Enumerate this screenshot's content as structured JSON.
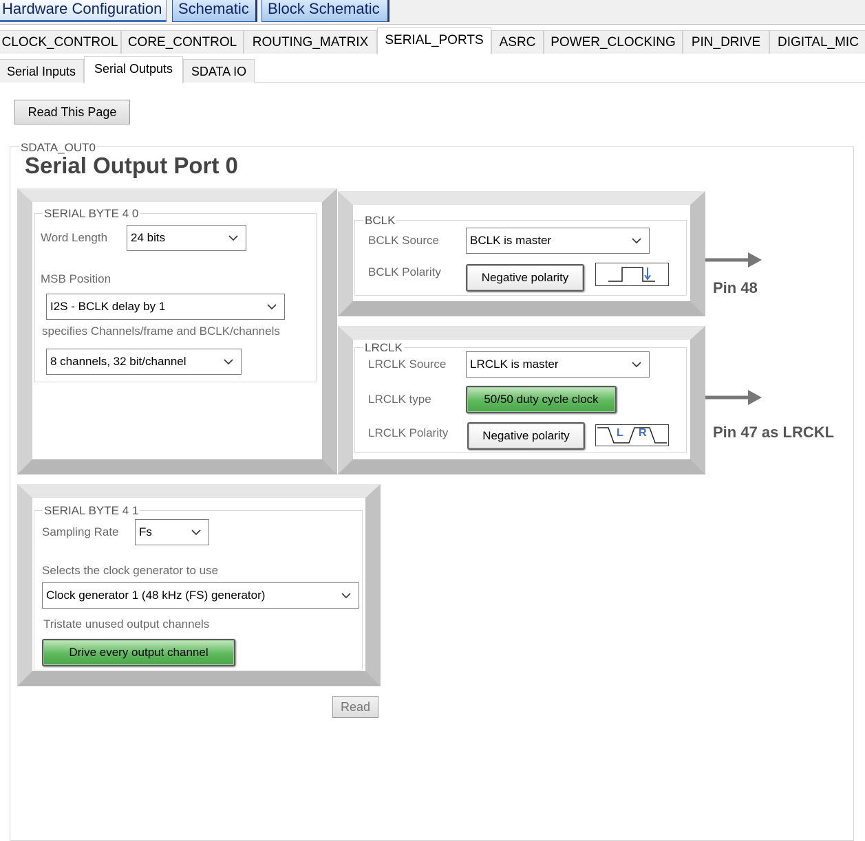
{
  "doc_tabs": [
    {
      "label": "Hardware Configuration",
      "active": true
    },
    {
      "label": "Schematic",
      "active": false
    },
    {
      "label": "Block Schematic",
      "active": false
    }
  ],
  "register_tabs": [
    {
      "label": "CLOCK_CONTROL"
    },
    {
      "label": "CORE_CONTROL"
    },
    {
      "label": "ROUTING_MATRIX"
    },
    {
      "label": "SERIAL_PORTS",
      "active": true
    },
    {
      "label": "ASRC"
    },
    {
      "label": "POWER_CLOCKING"
    },
    {
      "label": "PIN_DRIVE"
    },
    {
      "label": "DIGITAL_MIC"
    }
  ],
  "sub_tabs": [
    {
      "label": "Serial Inputs"
    },
    {
      "label": "Serial Outputs",
      "active": true
    },
    {
      "label": "SDATA IO"
    }
  ],
  "read_page_button": "Read This Page",
  "group": {
    "legend": "SDATA_OUT0",
    "title": "Serial Output Port 0"
  },
  "serial_byte_4_0": {
    "legend": "SERIAL BYTE 4 0",
    "word_length_label": "Word Length",
    "word_length_value": "24 bits",
    "msb_label": "MSB Position",
    "msb_value": "I2S - BCLK delay by 1",
    "channels_label": "specifies Channels/frame and BCLK/channels",
    "channels_value": "8 channels, 32 bit/channel"
  },
  "bclk": {
    "legend": "BCLK",
    "source_label": "BCLK Source",
    "source_value": "BCLK is master",
    "polarity_label": "BCLK Polarity",
    "polarity_button": "Negative polarity",
    "pin": "Pin 48"
  },
  "lrclk": {
    "legend": "LRCLK",
    "source_label": "LRCLK Source",
    "source_value": "LRCLK is master",
    "type_label": "LRCLK type",
    "type_button": "50/50 duty cycle clock",
    "polarity_label": "LRCLK Polarity",
    "polarity_button": "Negative polarity",
    "wave_left": "L",
    "wave_right": "R",
    "pin": "Pin 47 as LRCKL"
  },
  "serial_byte_4_1": {
    "legend": "SERIAL BYTE 4 1",
    "sampling_label": "Sampling Rate",
    "sampling_value": "Fs",
    "clockgen_label": "Selects the clock generator to use",
    "clockgen_value": "Clock generator 1 (48 kHz (FS) generator)",
    "tristate_label": "Tristate unused output channels",
    "tristate_button": "Drive every output channel"
  },
  "read_button": "Read",
  "colors": {
    "accent_blue": "#2f5ea4",
    "green_button": "#5fb95d",
    "wave_blue": "#3a6fd8"
  },
  "icons": [
    "chevron-down-icon",
    "arrow-right-icon",
    "clock-wave-icon"
  ]
}
